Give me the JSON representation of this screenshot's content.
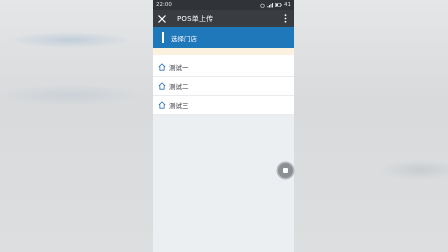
{
  "status_bar": {
    "time": "22:00",
    "battery": "41"
  },
  "app_bar": {
    "title": "POS单上传"
  },
  "banner": {
    "label": "选择门店"
  },
  "stores": [
    {
      "name": "测试一"
    },
    {
      "name": "测试二"
    },
    {
      "name": "测试三"
    }
  ],
  "colors": {
    "accent": "#1f78ba",
    "app_bar": "#393d41",
    "status_bar": "#303438"
  },
  "icons": {
    "close": "close-icon",
    "more": "more-vertical-icon",
    "store": "home-icon",
    "fab": "stop-icon"
  }
}
